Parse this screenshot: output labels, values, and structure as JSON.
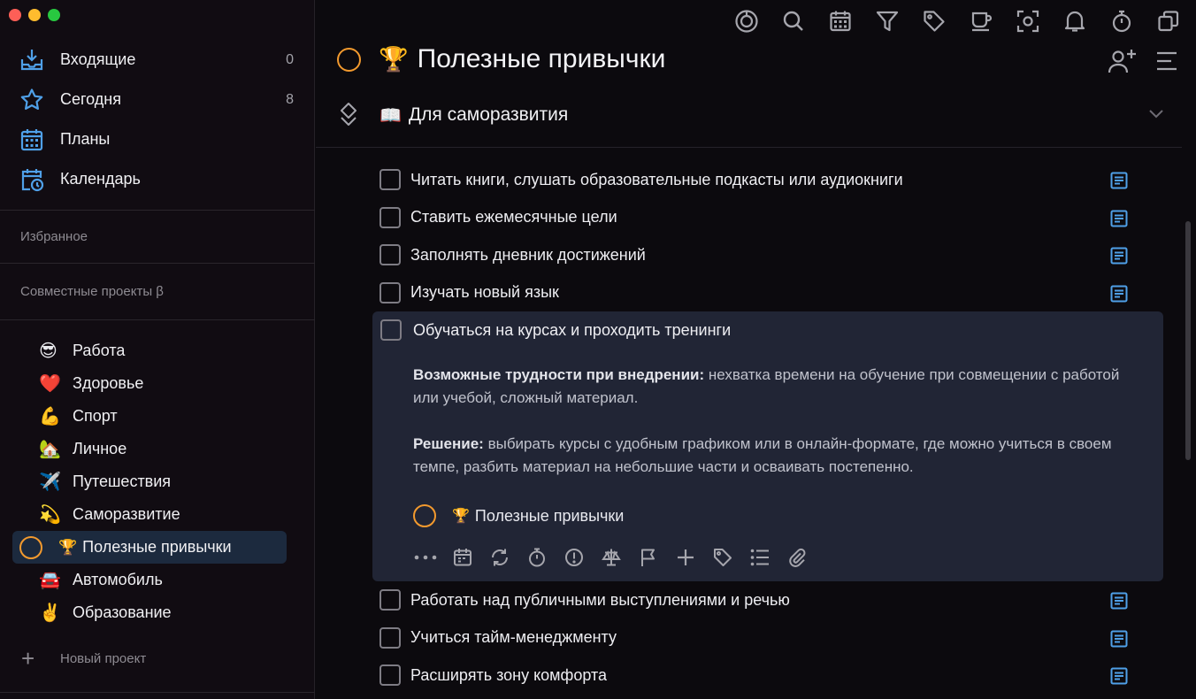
{
  "colors": {
    "accent_orange": "#f39a2e",
    "accent_blue": "#4fa0e8",
    "active_bg": "#1c2a3e",
    "expanded_bg": "#212535"
  },
  "sidebar": {
    "nav": [
      {
        "label": "Входящие",
        "count": "0",
        "icon": "inbox-icon"
      },
      {
        "label": "Сегодня",
        "count": "8",
        "icon": "star-icon"
      },
      {
        "label": "Планы",
        "count": "",
        "icon": "calendar-grid-icon"
      },
      {
        "label": "Календарь",
        "count": "",
        "icon": "calendar-clock-icon"
      }
    ],
    "favorites_label": "Избранное",
    "shared_label": "Совместные проекты β",
    "projects": [
      {
        "emoji": "😎",
        "label": "Работа"
      },
      {
        "emoji": "❤️",
        "label": "Здоровье"
      },
      {
        "emoji": "💪",
        "label": "Спорт"
      },
      {
        "emoji": "🏡",
        "label": "Личное"
      },
      {
        "emoji": "✈️",
        "label": "Путешествия"
      },
      {
        "emoji": "💫",
        "label": "Саморазвитие"
      },
      {
        "emoji": "🏆",
        "label": "Полезные привычки",
        "active": true
      },
      {
        "emoji": "🚘",
        "label": "Автомобиль"
      },
      {
        "emoji": "✌️",
        "label": "Образование"
      }
    ],
    "new_project_label": "Новый проект"
  },
  "toolbar": [
    "focus-icon",
    "search-icon",
    "calendar-icon",
    "filter-icon",
    "tag-icon",
    "coffee-icon",
    "scan-icon",
    "bell-icon",
    "timer-icon",
    "copy-icon"
  ],
  "main": {
    "title_emoji": "🏆",
    "title": "Полезные привычки",
    "section_emoji": "📖",
    "section_title": "Для саморазвития",
    "tasks_before": [
      "Читать книги, слушать образовательные подкасты или аудиокниги",
      "Ставить ежемесячные цели",
      "Заполнять дневник достижений",
      "Изучать новый язык"
    ],
    "expanded_task": {
      "title": "Обучаться на курсах и проходить тренинги",
      "difficulty_label": "Возможные трудности при внедрении:",
      "difficulty_text": " нехватка времени на обучение при совмещении с работой или учебой, сложный материал.",
      "solution_label": "Решение:",
      "solution_text": " выбирать курсы с удобным графиком или в онлайн-формате, где можно учиться в своем темпе, разбить материал на небольшие части и осваивать постепенно.",
      "project_emoji": "🏆",
      "project_label": "Полезные привычки"
    },
    "tasks_after": [
      "Работать над публичными выступлениями и речью",
      "Учиться тайм-менеджменту",
      "Расширять зону комфорта"
    ]
  }
}
